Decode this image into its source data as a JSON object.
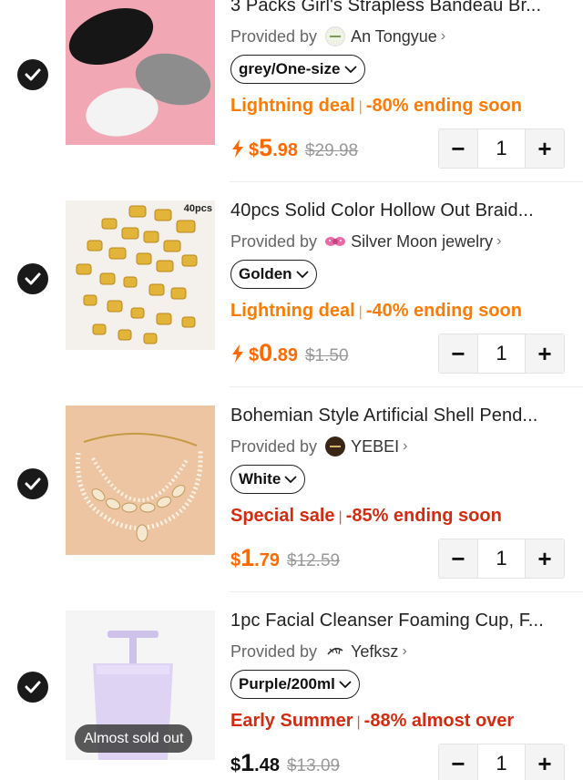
{
  "items": [
    {
      "title": "3 Packs Girl's Strapless Bandeau Br...",
      "provided_by_label": "Provided by",
      "store_name": "An Tongyue",
      "variant": "grey/One-size",
      "deal_label": "Lightning deal",
      "deal_separator": "|",
      "deal_text": "-80% ending soon",
      "deal_color": "#ff7a00",
      "currency": "$",
      "price_int": "5",
      "price_dec": ".98",
      "original_price": "$29.98",
      "quantity": "1",
      "selected": true,
      "minus_label": "−",
      "plus_label": "+"
    },
    {
      "title": "40pcs Solid Color Hollow Out Braid...",
      "provided_by_label": "Provided by",
      "store_name": "Silver Moon jewelry",
      "variant": "Golden",
      "deal_label": "Lightning deal",
      "deal_separator": "|",
      "deal_text": "-40% ending soon",
      "deal_color": "#ff7a00",
      "currency": "$",
      "price_int": "0",
      "price_dec": ".89",
      "original_price": "$1.50",
      "quantity": "1",
      "selected": true,
      "image_badge": "40pcs",
      "minus_label": "−",
      "plus_label": "+"
    },
    {
      "title": "Bohemian Style Artificial Shell Pend...",
      "provided_by_label": "Provided by",
      "store_name": "YEBEI",
      "variant": "White",
      "deal_label": "Special sale",
      "deal_separator": "|",
      "deal_text": "-85% ending soon",
      "deal_color": "#d42b10",
      "currency": "$",
      "price_int": "1",
      "price_dec": ".79",
      "original_price": "$12.59",
      "quantity": "1",
      "selected": true,
      "minus_label": "−",
      "plus_label": "+"
    },
    {
      "title": "1pc Facial Cleanser Foaming Cup, F...",
      "provided_by_label": "Provided by",
      "store_name": "Yefksz",
      "variant": "Purple/200ml",
      "deal_label": "Early Summer",
      "deal_separator": "|",
      "deal_text": "-88% almost over",
      "deal_color": "#d42b10",
      "currency": "$",
      "price_int": "1",
      "price_dec": ".48",
      "original_price": "$13.09",
      "quantity": "1",
      "selected": true,
      "image_badge": "Almost sold out",
      "minus_label": "−",
      "plus_label": "+"
    }
  ],
  "icons": {
    "check": "check-icon",
    "bolt": "lightning-bolt-icon",
    "chevron": "chevron-right-icon",
    "caret": "chevron-down-icon"
  },
  "colors": {
    "lightning_orange": "#ff7a00",
    "sale_red": "#d42b10",
    "price_orange": "#ff6a00"
  }
}
